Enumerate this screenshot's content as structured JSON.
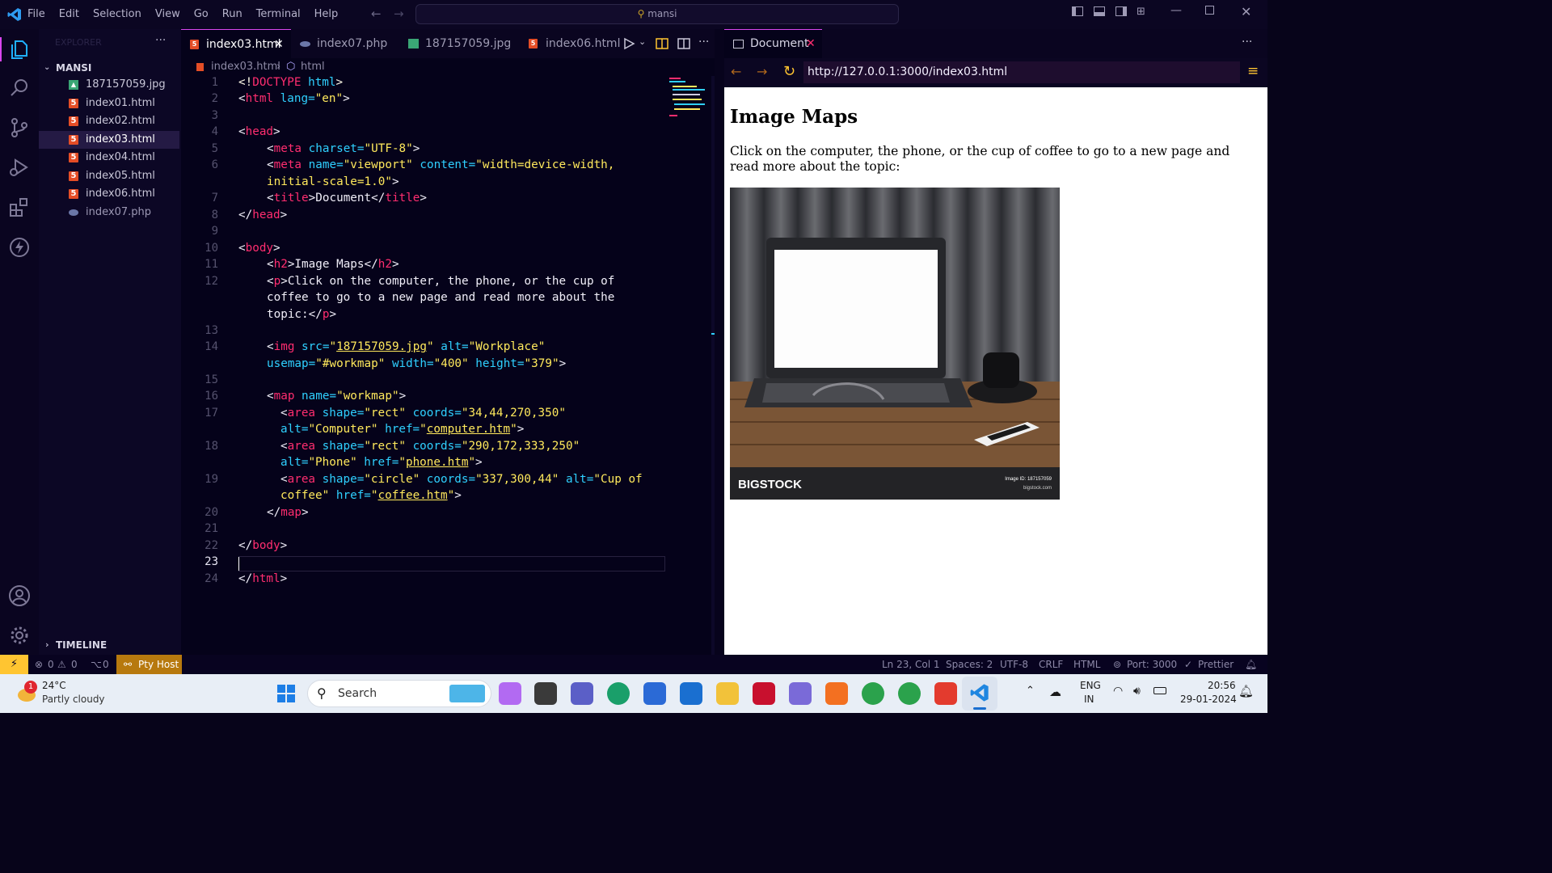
{
  "menu": [
    "File",
    "Edit",
    "Selection",
    "View",
    "Go",
    "Run",
    "Terminal",
    "Help"
  ],
  "command_center": "mansi",
  "sidebar": {
    "header": "EXPLORER",
    "folder": "MANSI",
    "files": [
      {
        "name": "187157059.jpg",
        "icon": "image-icon"
      },
      {
        "name": "index01.html",
        "icon": "html5-icon"
      },
      {
        "name": "index02.html",
        "icon": "html5-icon"
      },
      {
        "name": "index03.html",
        "icon": "html5-icon",
        "selected": true
      },
      {
        "name": "index04.html",
        "icon": "html5-icon"
      },
      {
        "name": "index05.html",
        "icon": "html5-icon"
      },
      {
        "name": "index06.html",
        "icon": "html5-icon"
      },
      {
        "name": "index07.php",
        "icon": "php-icon"
      }
    ],
    "timeline": "TIMELINE"
  },
  "tabs": [
    "index03.html",
    "index07.php",
    "187157059.jpg",
    "index06.html"
  ],
  "breadcrumb": {
    "file": "index03.html",
    "node": "html"
  },
  "line_numbers": [
    "1",
    "2",
    "3",
    "4",
    "5",
    "6",
    "7",
    "8",
    "9",
    "10",
    "11",
    "12",
    "13",
    "14",
    "15",
    "16",
    "17",
    "18",
    "19",
    "20",
    "21",
    "22",
    "23",
    "24"
  ],
  "code": {
    "l1a": "<!",
    "l1b": "DOCTYPE",
    "l1c": " html",
    "l1d": ">",
    "l2a": "<",
    "l2b": "html",
    "l2c": " lang=",
    "l2d": "\"en\"",
    "l2e": ">",
    "l4a": "<",
    "l4b": "head",
    "l4c": ">",
    "l5a": "<",
    "l5b": "meta",
    "l5c": " charset=",
    "l5d": "\"UTF-8\"",
    "l5e": ">",
    "l6a": "<",
    "l6b": "meta",
    "l6c": " name=",
    "l6d": "\"viewport\"",
    "l6e": " content=",
    "l6f": "\"width=device-width,",
    "l6g": "initial-scale=1.0\"",
    "l6h": ">",
    "l7a": "<",
    "l7b": "title",
    "l7c": ">Document</",
    "l7d": "title",
    "l7e": ">",
    "l8a": "</",
    "l8b": "head",
    "l8c": ">",
    "l10a": "<",
    "l10b": "body",
    "l10c": ">",
    "l11a": "<",
    "l11b": "h2",
    "l11c": ">Image Maps</",
    "l11d": "h2",
    "l11e": ">",
    "l12a": "<",
    "l12b": "p",
    "l12c": ">Click on the computer, the phone, or the cup of",
    "l12d": "coffee to go to a new page and read more about the",
    "l12e": "topic:</",
    "l12f": "p",
    "l12g": ">",
    "l14a": "<",
    "l14b": "img",
    "l14c": " src=",
    "l14d": "\"",
    "l14e": "187157059.jpg",
    "l14f": "\"",
    "l14g": " alt=",
    "l14h": "\"Workplace\"",
    "l14i": "usemap=",
    "l14j": "\"#workmap\"",
    "l14k": " width=",
    "l14l": "\"400\"",
    "l14m": " height=",
    "l14n": "\"379\"",
    "l14o": ">",
    "l16a": "<",
    "l16b": "map",
    "l16c": " name=",
    "l16d": "\"workmap\"",
    "l16e": ">",
    "l17a": "<",
    "l17b": "area",
    "l17c": " shape=",
    "l17d": "\"rect\"",
    "l17e": " coords=",
    "l17f": "\"34,44,270,350\"",
    "l17g": "alt=",
    "l17h": "\"Computer\"",
    "l17i": " href=",
    "l17j": "\"",
    "l17k": "computer.htm",
    "l17l": "\"",
    "l17m": ">",
    "l18a": "<",
    "l18b": "area",
    "l18c": " shape=",
    "l18d": "\"rect\"",
    "l18e": " coords=",
    "l18f": "\"290,172,333,250\"",
    "l18g": "alt=",
    "l18h": "\"Phone\"",
    "l18i": " href=",
    "l18j": "\"",
    "l18k": "phone.htm",
    "l18l": "\"",
    "l18m": ">",
    "l19a": "<",
    "l19b": "area",
    "l19c": " shape=",
    "l19d": "\"circle\"",
    "l19e": " coords=",
    "l19f": "\"337,300,44\"",
    "l19g": " alt=",
    "l19h": "\"Cup of",
    "l19i": "coffee\"",
    "l19j": " href=",
    "l19k": "\"",
    "l19l": "coffee.htm",
    "l19m": "\"",
    "l19n": ">",
    "l20a": "</",
    "l20b": "map",
    "l20c": ">",
    "l22a": "</",
    "l22b": "body",
    "l22c": ">",
    "l24a": "</",
    "l24b": "html",
    "l24c": ">"
  },
  "browser": {
    "tab": "Document",
    "url": "http://127.0.0.1:3000/index03.html",
    "heading": "Image Maps",
    "paragraph": "Click on the computer, the phone, or the cup of coffee to go to a new page and read more about the topic:",
    "image_brand": "BIGSTOCK",
    "image_id": "Image ID: 187157059",
    "image_site": "bigstock.com"
  },
  "status": {
    "errors": "0",
    "warnings": "0",
    "ports": "0",
    "pty": "Pty Host",
    "position": "Ln 23, Col 1",
    "spaces": "Spaces: 2",
    "encoding": "UTF-8",
    "eol": "CRLF",
    "language": "HTML",
    "port": "Port: 3000",
    "prettier": "Prettier"
  },
  "taskbar": {
    "weather_temp": "24°C",
    "weather_desc": "Partly cloudy",
    "weather_badge": "1",
    "search": "Search",
    "lang1": "ENG",
    "lang2": "IN",
    "time": "20:56",
    "date": "29-01-2024"
  },
  "colors": {
    "accent": "#d946ef",
    "tag": "#ff2d6f",
    "attr": "#2fd0ff",
    "string": "#ffe95c"
  }
}
